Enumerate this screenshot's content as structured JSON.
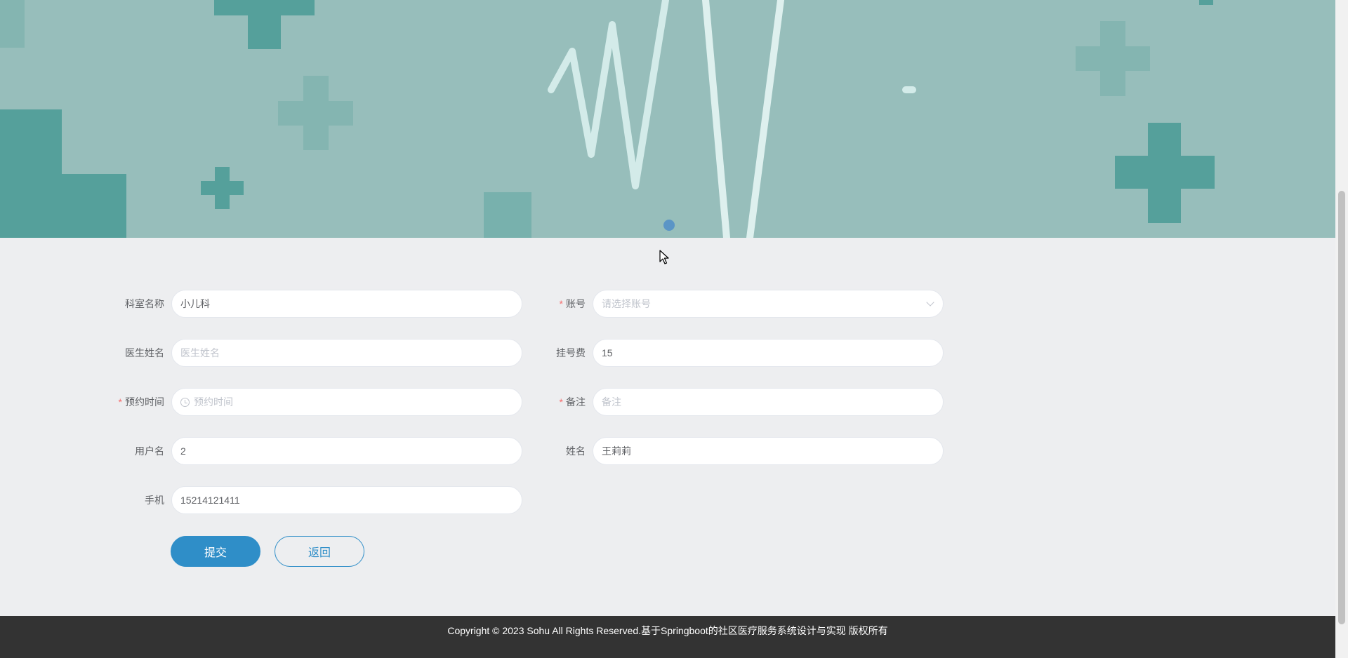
{
  "form": {
    "department": {
      "label": "科室名称",
      "value": "小儿科",
      "required": false
    },
    "account": {
      "label": "账号",
      "placeholder": "请选择账号",
      "required": true
    },
    "doctor_name": {
      "label": "医生姓名",
      "placeholder": "医生姓名",
      "required": false
    },
    "registration_fee": {
      "label": "挂号费",
      "value": "15",
      "required": false
    },
    "appointment_time": {
      "label": "预约时间",
      "placeholder": "预约时间",
      "required": true
    },
    "remark": {
      "label": "备注",
      "placeholder": "备注",
      "required": true
    },
    "username": {
      "label": "用户名",
      "value": "2",
      "required": false
    },
    "name": {
      "label": "姓名",
      "value": "王莉莉",
      "required": false
    },
    "phone": {
      "label": "手机",
      "value": "15214121411",
      "required": false
    },
    "required_mark": "*"
  },
  "buttons": {
    "submit": "提交",
    "back": "返回"
  },
  "footer": {
    "copyright": "Copyright © 2023 Sohu All Rights Reserved.基于Springboot的社区医疗服务系统设计与实现 版权所有"
  },
  "colors": {
    "banner_bg": "#97bebb",
    "cross_dark": "#55a09b",
    "cross_light": "#84b5b1",
    "primary": "#2f8ec8",
    "required": "#f56c6c",
    "footer_bg": "#333333",
    "page_bg": "#edeef0"
  },
  "icons": [
    "medical-cross-icon",
    "heartbeat-line-icon",
    "clock-icon",
    "chevron-down-icon",
    "mouse-cursor-icon"
  ]
}
